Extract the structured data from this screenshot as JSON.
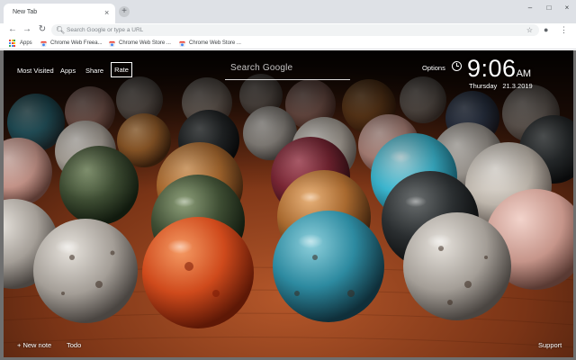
{
  "browser": {
    "tab_title": "New Tab",
    "tab_close": "×",
    "new_tab": "+",
    "window_controls": [
      "–",
      "□",
      "×"
    ],
    "nav": {
      "back": "←",
      "forward": "→",
      "reload": "↻"
    },
    "omnibox_placeholder": "Search Google or type a URL",
    "bookmarks": [
      {
        "label": "Apps",
        "icon": "apps-grid-icon"
      },
      {
        "label": "Chrome Web Freea...",
        "icon": "chrome-web-store-icon"
      },
      {
        "label": "Chrome Web Store ...",
        "icon": "chrome-web-store-icon"
      },
      {
        "label": "Chrome Web Store ...",
        "icon": "chrome-web-store-icon"
      }
    ]
  },
  "newtab": {
    "links": {
      "most_visited": "Most Visited",
      "apps": "Apps",
      "share": "Share",
      "rate": "Rate"
    },
    "search_placeholder": "Search Google",
    "options": "Options",
    "time": "9:06",
    "am_pm": "AM",
    "day": "Thursday",
    "date": "21.3.2019",
    "footer": {
      "new_note": "+ New note",
      "todo": "Todo",
      "support": "Support"
    }
  },
  "colors": {
    "chrome_bar": "#dee1e6",
    "omnibox": "#f1f3f4",
    "text_on_image": "#ffffff",
    "marble_table": "#8a3f1a"
  }
}
